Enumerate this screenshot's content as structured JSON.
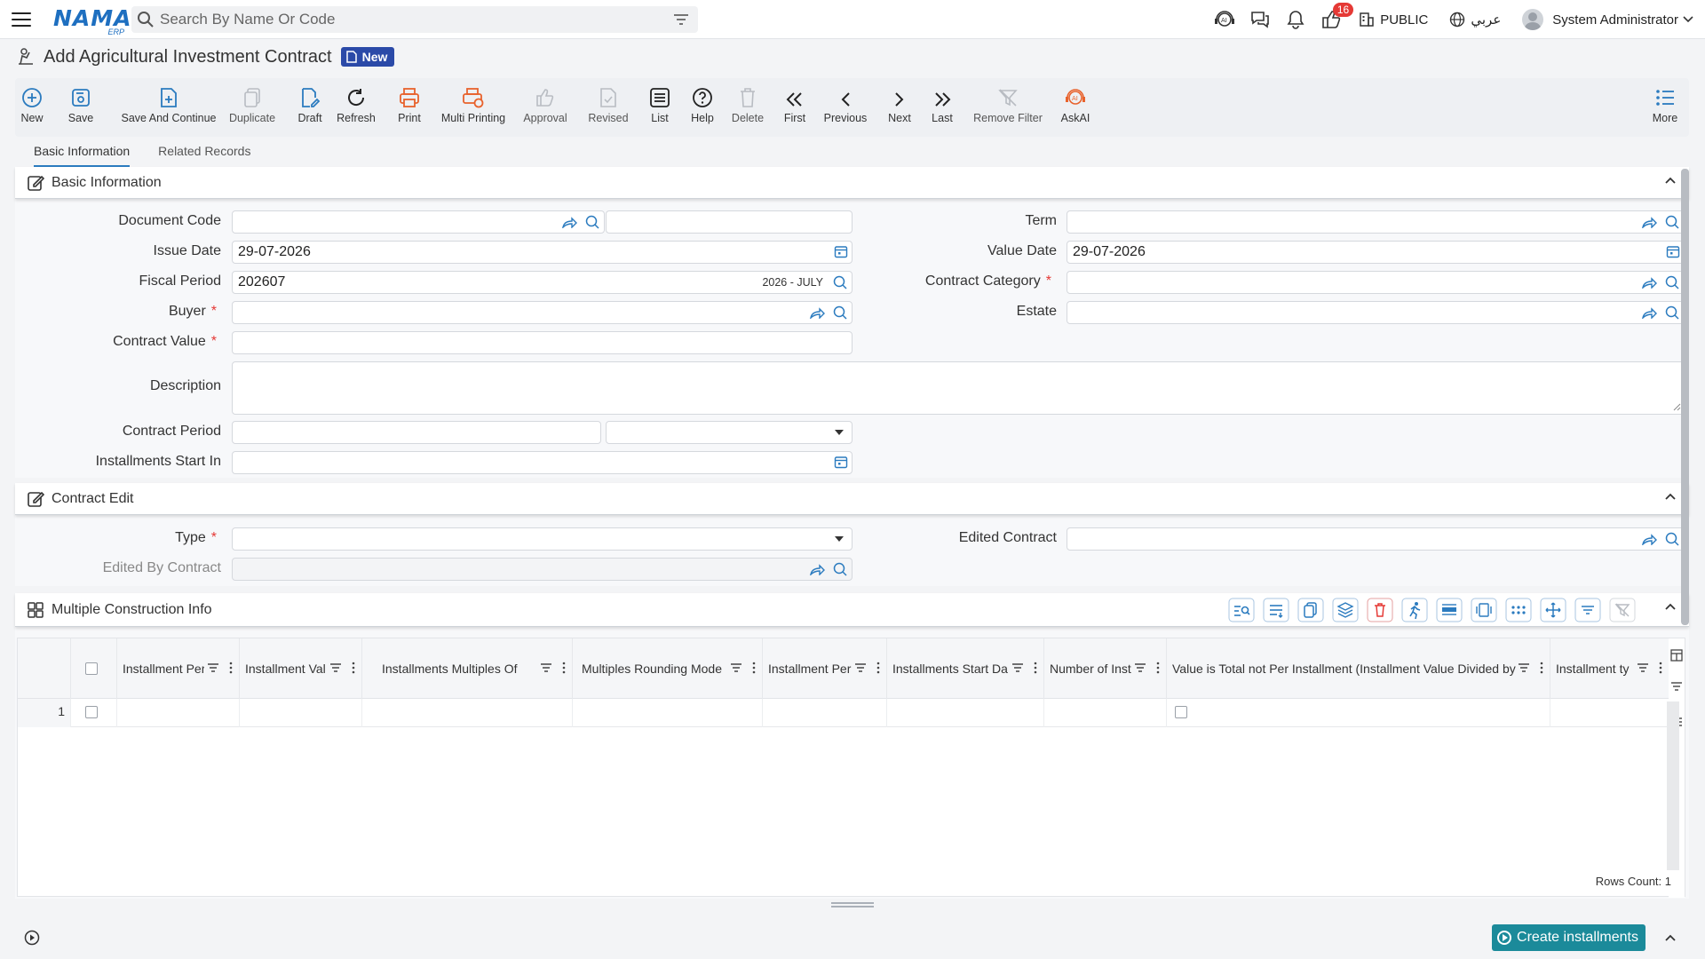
{
  "topbar": {
    "logo_text": "NAMA",
    "logo_sub": "ERP",
    "search_placeholder": "Search By Name Or Code",
    "notifications_count": "16",
    "branch": "PUBLIC",
    "language": "عربي",
    "user_name": "System Administrator"
  },
  "page": {
    "title": "Add Agricultural Investment Contract",
    "badge": "New"
  },
  "toolbar": {
    "new": "New",
    "save": "Save",
    "save_continue": "Save And Continue",
    "duplicate": "Duplicate",
    "draft": "Draft",
    "refresh": "Refresh",
    "print": "Print",
    "multi_printing": "Multi Printing",
    "approval": "Approval",
    "revised": "Revised",
    "list": "List",
    "help": "Help",
    "delete": "Delete",
    "first": "First",
    "previous": "Previous",
    "next": "Next",
    "last": "Last",
    "remove_filter": "Remove Filter",
    "askai": "AskAI",
    "more": "More"
  },
  "tabs": [
    "Basic Information",
    "Related Records"
  ],
  "basic_info": {
    "title": "Basic Information",
    "document_code_label": "Document Code",
    "issue_date_label": "Issue Date",
    "issue_date_value": "29-07-2026",
    "fiscal_period_label": "Fiscal Period",
    "fiscal_period_value": "202607",
    "fiscal_period_name": "2026 - JULY",
    "buyer_label": "Buyer",
    "contract_value_label": "Contract Value",
    "description_label": "Description",
    "contract_period_label": "Contract Period",
    "installments_start_label": "Installments Start In",
    "term_label": "Term",
    "value_date_label": "Value Date",
    "value_date_value": "29-07-2026",
    "contract_category_label": "Contract Category",
    "estate_label": "Estate",
    "required_mark": "*"
  },
  "contract_edit": {
    "title": "Contract Edit",
    "type_label": "Type",
    "edited_by_label": "Edited By Contract",
    "edited_contract_label": "Edited Contract"
  },
  "construction": {
    "title": "Multiple Construction Info",
    "columns": [
      "Installment Per",
      "Installment Val",
      "Installments Multiples Of",
      "Multiples Rounding Mode",
      "Installment Per",
      "Installments Start Da",
      "Number of Inst",
      "Value is Total not Per Installment (Installment Value Divided by I",
      "Installment ty"
    ],
    "row_number": "1",
    "rows_count": "Rows Count: 1"
  },
  "footer": {
    "create_installments": "Create installments"
  },
  "colors": {
    "accent": "#2b7bbf",
    "badge_blue": "#2b4aa8",
    "print_orange": "#e8622c",
    "create_button": "#1b8a9a",
    "required": "#e53935"
  }
}
